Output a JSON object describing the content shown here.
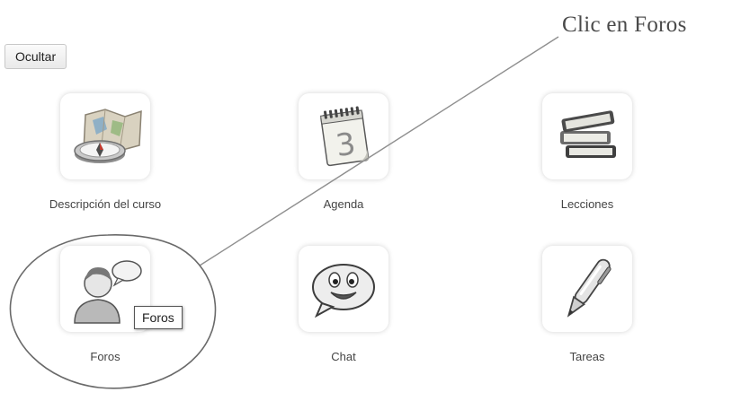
{
  "toolbar": {
    "hide_label": "Ocultar"
  },
  "tools": [
    {
      "label": "Descripción del curso",
      "icon": "compass-map-icon"
    },
    {
      "label": "Agenda",
      "icon": "calendar-icon",
      "calendar_day": "3"
    },
    {
      "label": "Lecciones",
      "icon": "books-icon"
    },
    {
      "label": "Foros",
      "icon": "forum-users-icon"
    },
    {
      "label": "Chat",
      "icon": "chat-bubble-icon"
    },
    {
      "label": "Tareas",
      "icon": "pen-icon"
    }
  ],
  "tooltip": {
    "text": "Foros"
  },
  "annotation": {
    "text": "Clic en Foros"
  }
}
